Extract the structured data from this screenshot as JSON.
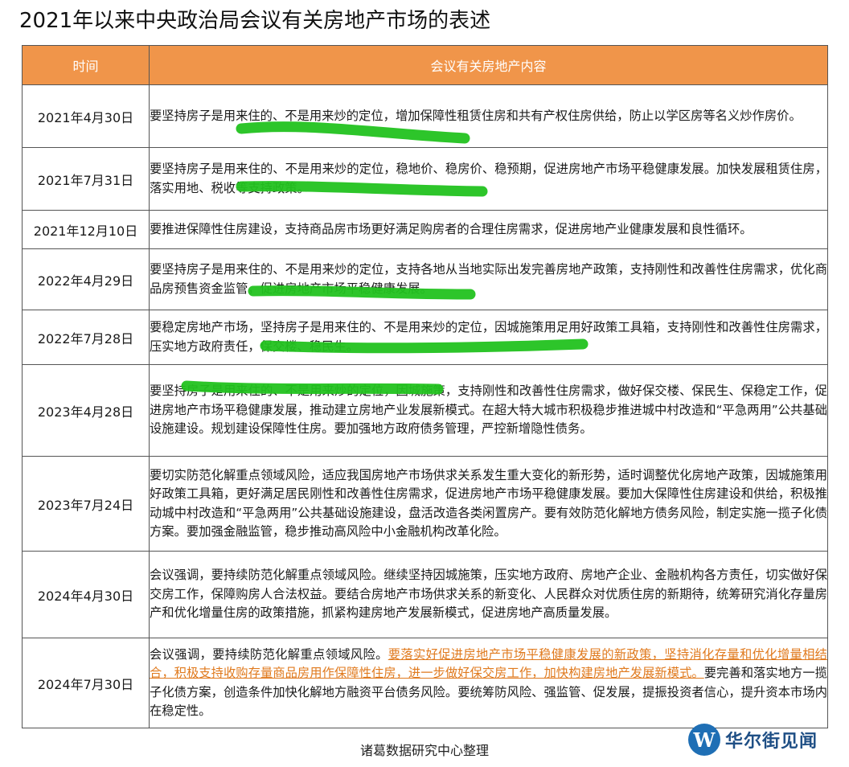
{
  "title": "2021年以来中央政治局会议有关房地产市场的表述",
  "table": {
    "headers": [
      "时间",
      "会议有关房地产内容"
    ],
    "rows": [
      {
        "date": "2021年4月30日",
        "content": "要坚持房子是用来住的、不是用来炒的定位，增加保障性租赁住房和共有产权住房供给，防止以学区房等名义炒作房价。"
      },
      {
        "date": "2021年7月31日",
        "content": "要坚持房子是用来住的、不是用来炒的定位，稳地价、稳房价、稳预期，促进房地产市场平稳健康发展。加快发展租赁住房，落实用地、税收等支持政策。"
      },
      {
        "date": "2021年12月10日",
        "content": "要推进保障性住房建设，支持商品房市场更好满足购房者的合理住房需求，促进房地产业健康发展和良性循环。"
      },
      {
        "date": "2022年4月29日",
        "content": "要坚持房子是用来住的、不是用来炒的定位，支持各地从当地实际出发完善房地产政策，支持刚性和改善性住房需求，优化商品房预售资金监管，促进房地产市场平稳健康发展。"
      },
      {
        "date": "2022年7月28日",
        "content": "要稳定房地产市场，坚持房子是用来住的、不是用来炒的定位，因城施策用足用好政策工具箱，支持刚性和改善性住房需求，压实地方政府责任，保交楼、稳民生。"
      },
      {
        "date": "2023年4月28日",
        "content": "要坚持房子是用来住的、不是用来炒的定位，因城施策，支持刚性和改善性住房需求，做好保交楼、保民生、保稳定工作，促进房地产市场平稳健康发展，推动建立房地产业发展新模式。在超大特大城市积极稳步推进城中村改造和“平急两用”公共基础设施建设。规划建设保障性住房。要加强地方政府债务管理，严控新增隐性债务。"
      },
      {
        "date": "2023年7月24日",
        "content": "要切实防范化解重点领域风险，适应我国房地产市场供求关系发生重大变化的新形势，适时调整优化房地产政策，因城施策用好政策工具箱，更好满足居民刚性和改善性住房需求，促进房地产市场平稳健康发展。要加大保障性住房建设和供给，积极推动城中村改造和“平急两用”公共基础设施建设，盘活改造各类闲置房产。要有效防范化解地方债务风险，制定实施一揽子化债方案。要加强金融监管，稳步推动高风险中小金融机构改革化险。"
      },
      {
        "date": "2024年4月30日",
        "content": "会议强调，要持续防范化解重点领域风险。继续坚持因城施策，压实地方政府、房地产企业、金融机构各方责任，切实做好保交房工作，保障购房人合法权益。要结合房地产市场供求关系的新变化、人民群众对优质住房的新期待，统筹研究消化存量房产和优化增量住房的政策措施，抓紧构建房地产发展新模式，促进房地产高质量发展。"
      },
      {
        "date": "2024年7月30日",
        "content_a": "会议强调，要持续防范化解重点领域风险。",
        "content_hl": "要落实好促进房地产市场平稳健康发展的新政策，坚持消化存量和优化增量相结合，积极支持收购存量商品房用作保障性住房，进一步做好保交房工作，加快构建房地产发展新模式。",
        "content_b": "要完善和落实地方一揽子化债方案，创造条件加快化解地方融资平台债务风险。要统筹防风险、强监管、促发展，提振投资者信心，提升资本市场内在稳定性。"
      }
    ]
  },
  "footer": "诸葛数据研究中心整理",
  "watermark": {
    "glyph": "W",
    "text": "华尔街见闻"
  },
  "colors": {
    "header_bg": "#f0954a",
    "highlight": "#e07a1e",
    "marker": "#22c21f",
    "logo": "#1f6fb5"
  }
}
